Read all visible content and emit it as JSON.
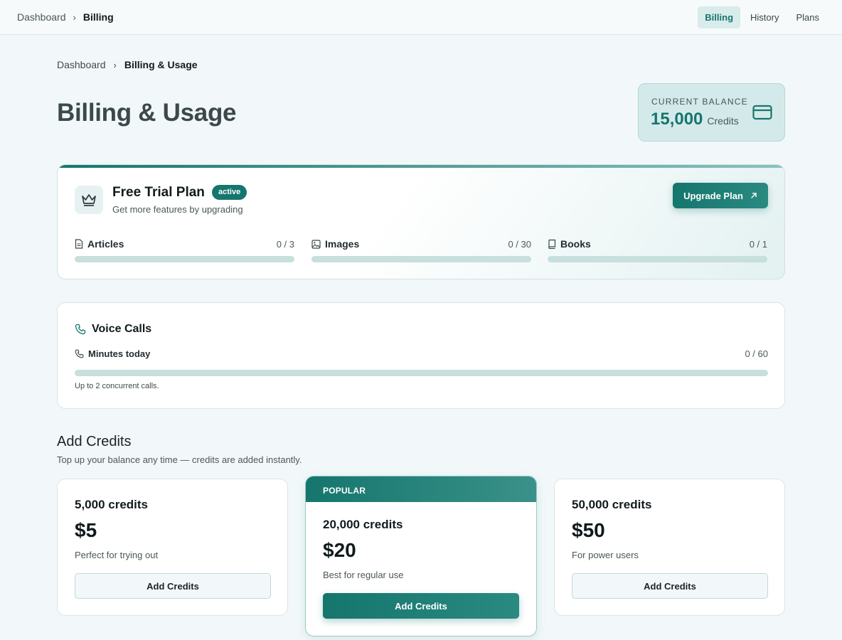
{
  "topbar": {
    "breadcrumb": {
      "parent": "Dashboard",
      "current": "Billing"
    },
    "nav": [
      {
        "label": "Billing",
        "active": true
      },
      {
        "label": "History",
        "active": false
      },
      {
        "label": "Plans",
        "active": false
      }
    ]
  },
  "breadcrumb": {
    "parent": "Dashboard",
    "current": "Billing & Usage"
  },
  "page_title": "Billing & Usage",
  "balance": {
    "label": "CURRENT BALANCE",
    "amount": "15,000",
    "unit": "Credits",
    "icon": "credit-card-icon"
  },
  "plan": {
    "name": "Free Trial Plan",
    "status": "active",
    "subtitle": "Get more features by upgrading",
    "upgrade_label": "Upgrade Plan",
    "quotas": [
      {
        "label": "Articles",
        "value": "0 / 3",
        "fraction": 0,
        "icon": "document-icon"
      },
      {
        "label": "Images",
        "value": "0 / 30",
        "fraction": 0,
        "icon": "image-icon"
      },
      {
        "label": "Books",
        "value": "0 / 1",
        "fraction": 0,
        "icon": "book-icon"
      }
    ]
  },
  "voice": {
    "title": "Voice Calls",
    "row_label": "Minutes today",
    "row_value": "0 / 60",
    "fraction": 0,
    "note": "Up to 2 concurrent calls."
  },
  "add_credits": {
    "title": "Add Credits",
    "subtitle": "Top up your balance any time — credits are added instantly.",
    "packs": [
      {
        "credits": "5,000 credits",
        "price": "$5",
        "desc": "Perfect for trying out",
        "button": "Add Credits"
      },
      {
        "badge": "POPULAR",
        "credits": "20,000 credits",
        "price": "$20",
        "desc": "Best for regular use",
        "button": "Add Credits"
      },
      {
        "credits": "50,000 credits",
        "price": "$50",
        "desc": "For power users",
        "button": "Add Credits"
      }
    ]
  },
  "colors": {
    "accent": "#15766d",
    "bar_track": "#c7dfdd",
    "page_bg": "#f2f8f9"
  }
}
